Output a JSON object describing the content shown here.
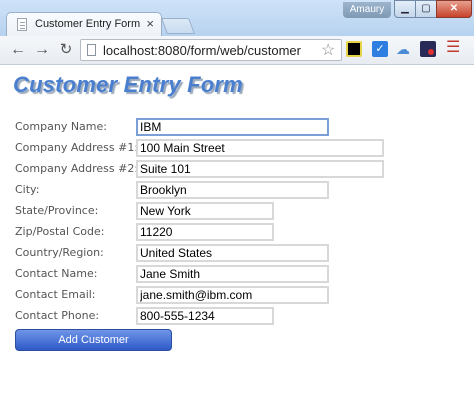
{
  "browser": {
    "tab_title": "Customer Entry Form",
    "tab_close": "×",
    "user_name": "Amaury",
    "url": "localhost:8080/form/web/customer"
  },
  "page": {
    "title": "Customer Entry Form",
    "fields": [
      {
        "label": "Company Name:",
        "value": "IBM"
      },
      {
        "label": "Company Address #1:",
        "value": "100 Main Street"
      },
      {
        "label": "Company Address #2:",
        "value": "Suite 101"
      },
      {
        "label": "City:",
        "value": "Brooklyn"
      },
      {
        "label": "State/Province:",
        "value": "New York"
      },
      {
        "label": "Zip/Postal Code:",
        "value": "11220"
      },
      {
        "label": "Country/Region:",
        "value": "United States"
      },
      {
        "label": "Contact Name:",
        "value": "Jane Smith"
      },
      {
        "label": "Contact Email:",
        "value": "jane.smith@ibm.com"
      },
      {
        "label": "Contact Phone:",
        "value": "800-555-1234"
      }
    ],
    "submit_label": "Add Customer"
  },
  "colors": {
    "title": "#4a7fd0",
    "button": "#2e59c8",
    "focus_border": "#7a9fd6"
  }
}
